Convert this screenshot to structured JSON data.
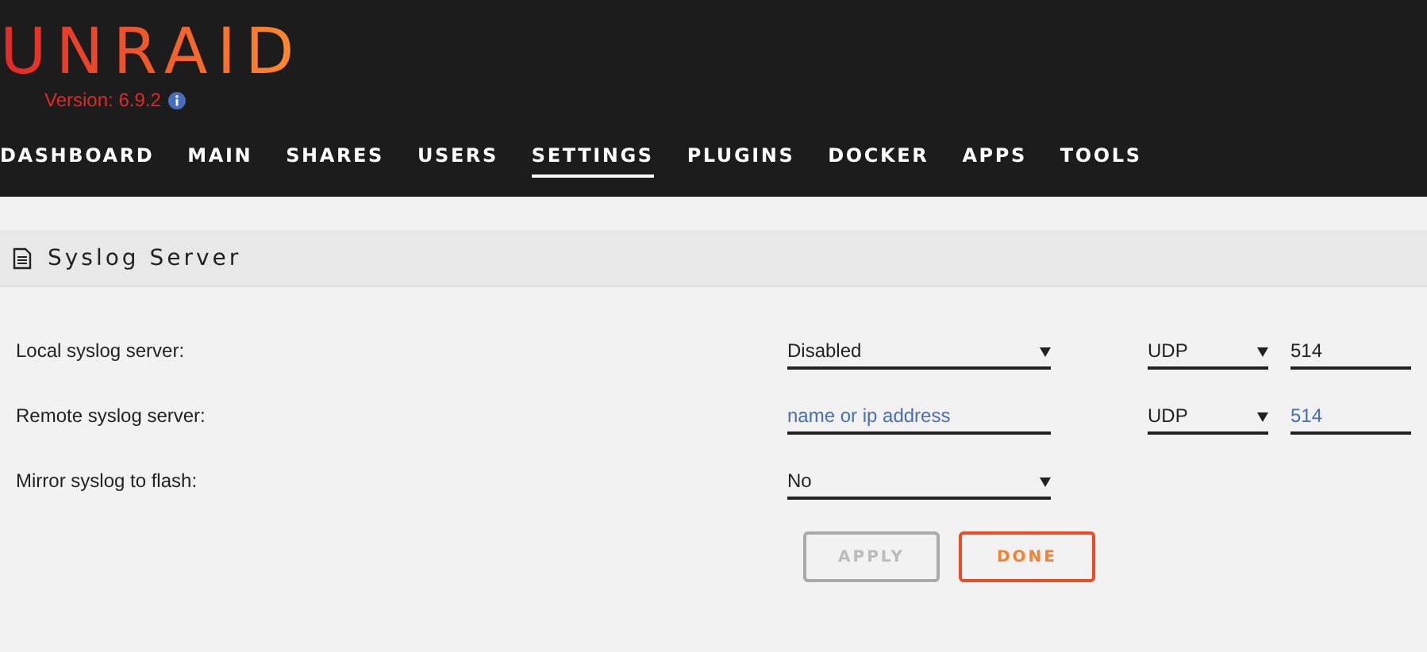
{
  "logo": {
    "text": "UNRAID",
    "version": "Version: 6.9.2"
  },
  "nav": [
    {
      "label": "DASHBOARD",
      "selected": false
    },
    {
      "label": "MAIN",
      "selected": false
    },
    {
      "label": "SHARES",
      "selected": false
    },
    {
      "label": "USERS",
      "selected": false
    },
    {
      "label": "SETTINGS",
      "selected": true
    },
    {
      "label": "PLUGINS",
      "selected": false
    },
    {
      "label": "DOCKER",
      "selected": false
    },
    {
      "label": "APPS",
      "selected": false
    },
    {
      "label": "TOOLS",
      "selected": false
    }
  ],
  "section": {
    "title": "Syslog Server"
  },
  "rows": [
    {
      "label": "Local syslog server:",
      "fields": [
        {
          "kind": "select",
          "value": "Disabled"
        },
        {
          "kind": "select",
          "value": "UDP"
        },
        {
          "kind": "input",
          "value": "514"
        }
      ]
    },
    {
      "label": "Remote syslog server:",
      "fields": [
        {
          "kind": "input",
          "placeholder": "name or ip address"
        },
        {
          "kind": "select",
          "value": "UDP"
        },
        {
          "kind": "input",
          "placeholder": "514"
        }
      ]
    },
    {
      "label": "Mirror syslog to flash:",
      "fields": [
        {
          "kind": "select",
          "value": "No"
        }
      ]
    }
  ],
  "buttons": [
    {
      "label": "APPLY",
      "disabled": true
    },
    {
      "label": "DONE",
      "disabled": false
    }
  ]
}
